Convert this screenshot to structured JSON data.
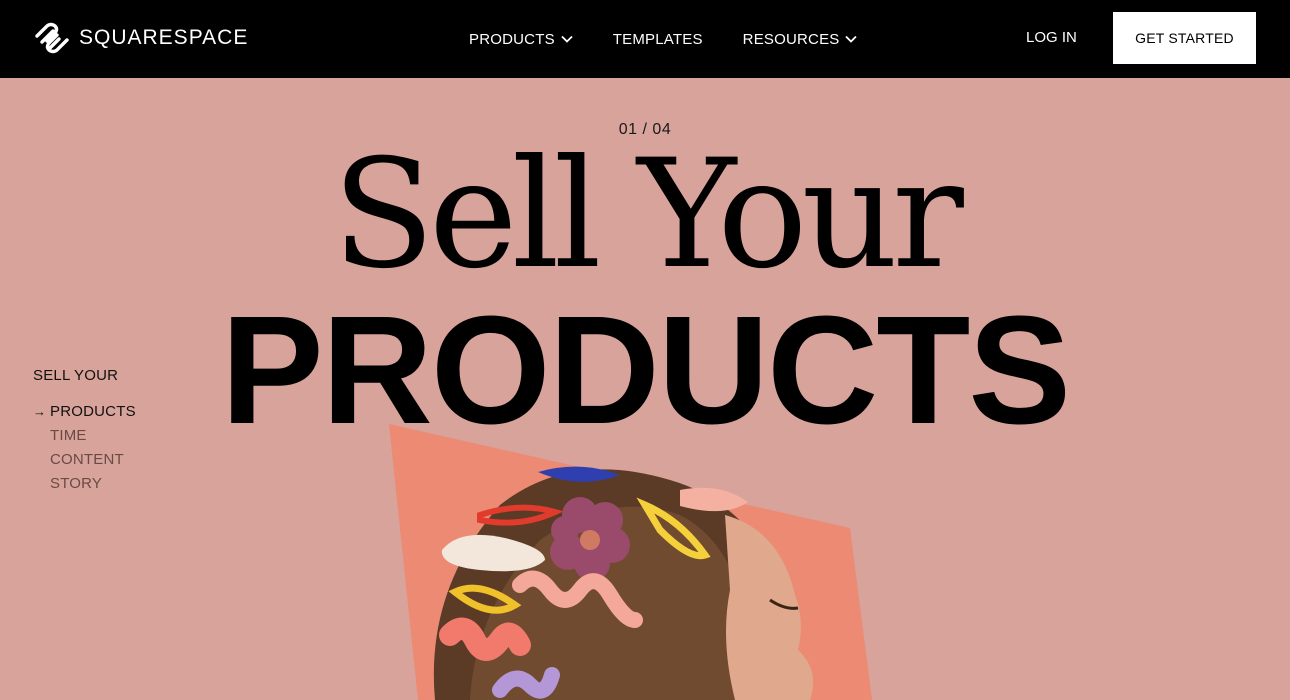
{
  "header": {
    "brand": "SQUARESPACE",
    "nav": [
      {
        "label": "PRODUCTS",
        "has_dropdown": true
      },
      {
        "label": "TEMPLATES",
        "has_dropdown": false
      },
      {
        "label": "RESOURCES",
        "has_dropdown": true
      }
    ],
    "login_label": "LOG IN",
    "cta_label": "GET STARTED"
  },
  "hero": {
    "counter": "01 / 04",
    "headline_serif": "Sell Your",
    "headline_sans": "PRODUCTS"
  },
  "side_nav": {
    "title": "SELL YOUR",
    "arrow": "→",
    "items": [
      {
        "label": "PRODUCTS",
        "active": true
      },
      {
        "label": "TIME",
        "active": false
      },
      {
        "label": "CONTENT",
        "active": false
      },
      {
        "label": "STORY",
        "active": false
      }
    ]
  },
  "colors": {
    "background": "#d8a39a",
    "header": "#000000",
    "accent_panel": "#ec8a74"
  }
}
